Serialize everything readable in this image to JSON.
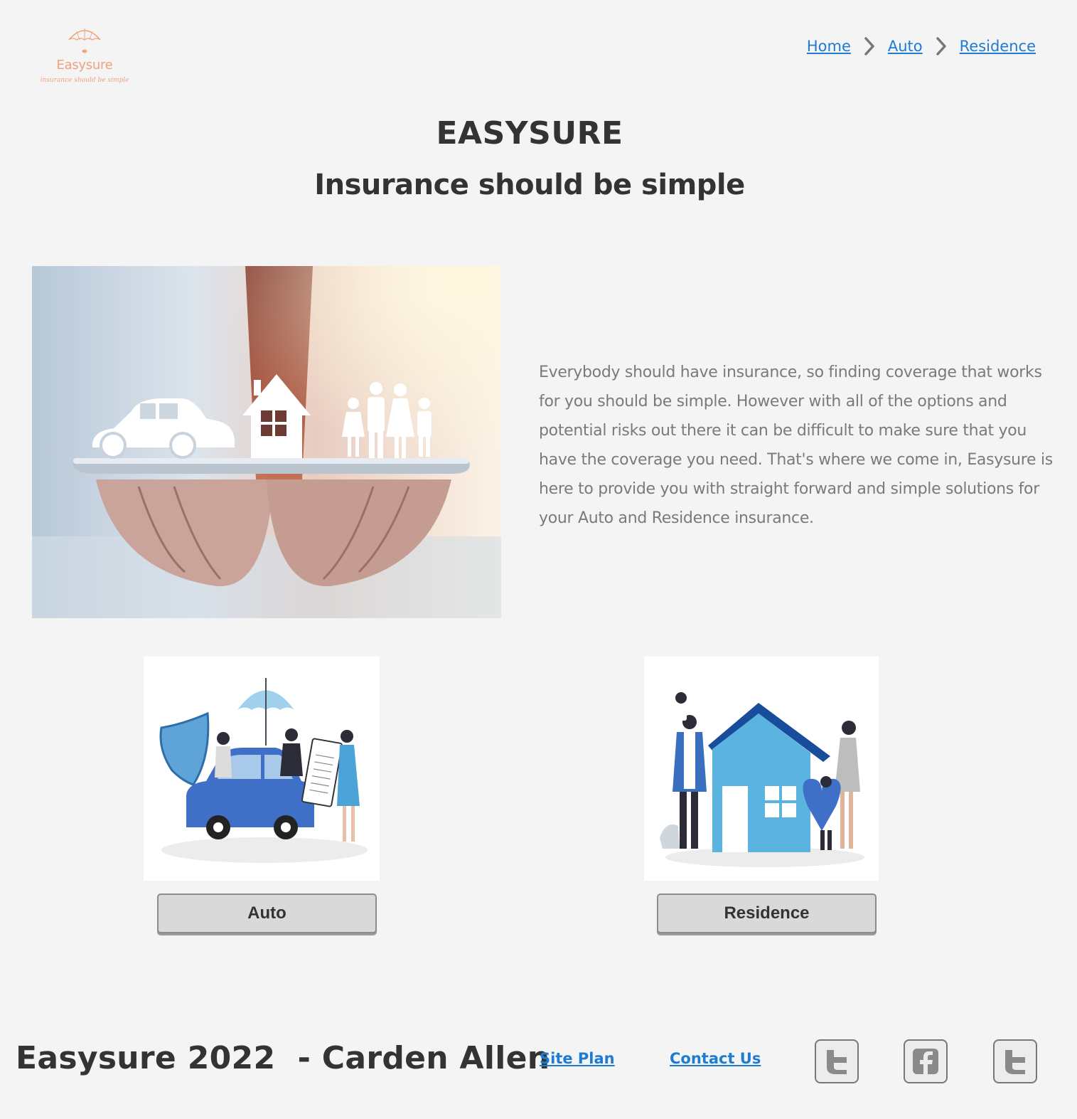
{
  "logo": {
    "name": "Easysure",
    "tagline": "insurance should be simple",
    "color": "#f0a27a"
  },
  "breadcrumb": {
    "items": [
      {
        "label": "Home"
      },
      {
        "label": "Auto"
      },
      {
        "label": "Residence"
      }
    ],
    "separator_icon": "chevron-right-icon",
    "link_color": "#1e7bd2"
  },
  "hero": {
    "title": "EASYSURE",
    "subtitle": "Insurance should be simple",
    "image_icon": "hands-holding-car-house-family",
    "paragraph": "Everybody should have insurance, so finding coverage that works for you should be simple. However with all of the options and potential risks out there it can be difficult to make sure that you have the coverage you need. That's where we come in, Easysure is here to provide you with straight forward and simple solutions for your Auto and Residence insurance."
  },
  "cards": [
    {
      "button_label": "Auto",
      "image_icon": "car-insurance-illustration"
    },
    {
      "button_label": "Residence",
      "image_icon": "house-insurance-illustration"
    }
  ],
  "footer": {
    "credit": "Easysure 2022  - Carden Allen",
    "links": [
      {
        "label": "Site Plan"
      },
      {
        "label": "Contact Us"
      }
    ],
    "social_icons": [
      "twitter-icon",
      "facebook-icon",
      "twitter-icon"
    ]
  }
}
